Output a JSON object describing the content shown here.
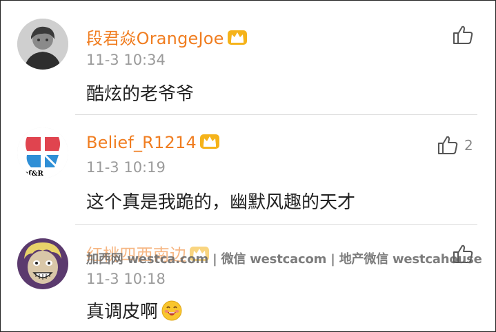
{
  "comments": [
    {
      "username": "段君焱OrangeJoe",
      "timestamp": "11-3 10:34",
      "content": "酷炫的老爷爷",
      "like_count": "",
      "avatar": "person-photo-avatar",
      "badge": "crown-icon"
    },
    {
      "username": "Belief_R1214",
      "timestamp": "11-3 10:19",
      "content": "这个真是我跪的，幽默风趣的天才",
      "like_count": "2",
      "avatar": "belief-logo-avatar",
      "avatar_text": "ief&R",
      "badge": "crown-icon"
    },
    {
      "username": "红桃四西南边",
      "timestamp": "11-3 10:18",
      "content": "真调皮啊",
      "like_count": "",
      "avatar": "cartoon-character-avatar",
      "badge": "crown-icon",
      "content_emoji": "blushing-smile-emoji"
    }
  ],
  "watermark": "加西网 westca.com | 微信 westcacom | 地产微信 westcahouse",
  "colors": {
    "username": "#f07d20",
    "timestamp": "#9b9b9b",
    "content": "#222222",
    "divider": "#dcdcdc"
  }
}
